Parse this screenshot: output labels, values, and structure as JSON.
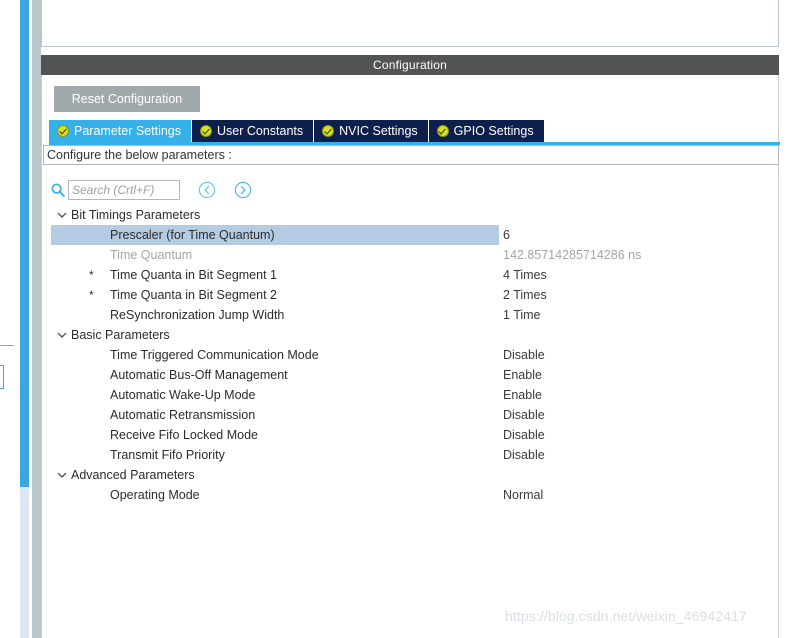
{
  "window": {
    "config_title": "Configuration"
  },
  "toolbar": {
    "reset_label": "Reset Configuration"
  },
  "tabs": [
    {
      "label": "Parameter Settings",
      "active": true,
      "icon": "check-circle-icon"
    },
    {
      "label": "User Constants",
      "active": false,
      "icon": "check-circle-icon"
    },
    {
      "label": "NVIC Settings",
      "active": false,
      "icon": "check-circle-icon"
    },
    {
      "label": "GPIO Settings",
      "active": false,
      "icon": "check-circle-icon"
    }
  ],
  "configure_bar": {
    "text": "Configure the below parameters :"
  },
  "search": {
    "placeholder": "Search (Crtl+F)",
    "value": "",
    "icon": "search-icon",
    "prev_icon": "chevron-left-circle-icon",
    "next_icon": "chevron-right-circle-icon"
  },
  "tree": [
    {
      "type": "group",
      "label": "Bit Timings Parameters",
      "expanded": true,
      "chevron": "chevron-down-icon"
    },
    {
      "type": "param",
      "label": "Prescaler (for Time Quantum)",
      "value": "6",
      "selected": true,
      "star": "",
      "dim": false
    },
    {
      "type": "param",
      "label": "Time Quantum",
      "value": "142.85714285714286 ns",
      "selected": false,
      "star": "",
      "dim": true
    },
    {
      "type": "param",
      "label": "Time Quanta in Bit Segment 1",
      "value": "4 Times",
      "selected": false,
      "star": "*",
      "dim": false
    },
    {
      "type": "param",
      "label": "Time Quanta in Bit Segment 2",
      "value": "2 Times",
      "selected": false,
      "star": "*",
      "dim": false
    },
    {
      "type": "param",
      "label": "ReSynchronization Jump Width",
      "value": "1 Time",
      "selected": false,
      "star": "",
      "dim": false
    },
    {
      "type": "group",
      "label": "Basic Parameters",
      "expanded": true,
      "chevron": "chevron-down-icon"
    },
    {
      "type": "param",
      "label": "Time Triggered Communication Mode",
      "value": "Disable",
      "selected": false,
      "star": "",
      "dim": false
    },
    {
      "type": "param",
      "label": "Automatic Bus-Off Management",
      "value": "Enable",
      "selected": false,
      "star": "",
      "dim": false
    },
    {
      "type": "param",
      "label": "Automatic Wake-Up Mode",
      "value": "Enable",
      "selected": false,
      "star": "",
      "dim": false
    },
    {
      "type": "param",
      "label": "Automatic Retransmission",
      "value": "Disable",
      "selected": false,
      "star": "",
      "dim": false
    },
    {
      "type": "param",
      "label": "Receive Fifo Locked Mode",
      "value": "Disable",
      "selected": false,
      "star": "",
      "dim": false
    },
    {
      "type": "param",
      "label": "Transmit Fifo Priority",
      "value": "Disable",
      "selected": false,
      "star": "",
      "dim": false
    },
    {
      "type": "group",
      "label": "Advanced Parameters",
      "expanded": true,
      "chevron": "chevron-down-icon"
    },
    {
      "type": "param",
      "label": "Operating Mode",
      "value": "Normal",
      "selected": false,
      "star": "",
      "dim": false
    }
  ],
  "watermark": {
    "text": "https://blog.csdn.net/weixin_46942417"
  },
  "colors": {
    "accent_blue": "#35b0e8",
    "tab_inactive": "#0c1f4d",
    "titlebar": "#525453",
    "selection": "#b4cbe2",
    "reset_button": "#a2a9ad",
    "check_yellow": "#d9e021"
  }
}
